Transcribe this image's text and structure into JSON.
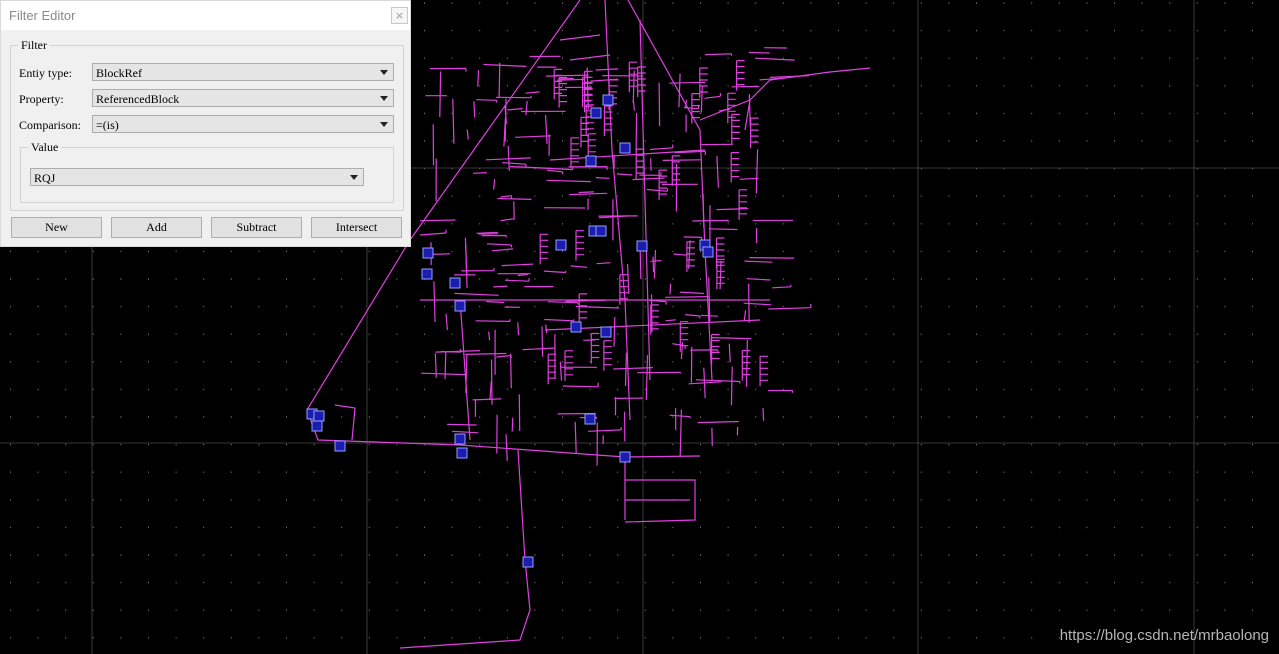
{
  "dialog": {
    "title": "Filter Editor",
    "close_label": "×",
    "filter_group_label": "Filter",
    "entity_type_label": "Entiy type:",
    "entity_type_value": "BlockRef",
    "property_label": "Property:",
    "property_value": "ReferencedBlock",
    "comparison_label": "Comparison:",
    "comparison_value": "=(is)",
    "value_group_label": "Value",
    "value_value": "RQJ",
    "buttons": {
      "new": "New",
      "add": "Add",
      "subtract": "Subtract",
      "intersect": "Intersect"
    }
  },
  "watermark": "https://blog.csdn.net/mrbaolong",
  "colors": {
    "background": "#000000",
    "pipe": "#e040e0",
    "marker_fill": "#1c1cb0",
    "marker_stroke": "#8fa0ff",
    "grid": "#4a4a4a"
  }
}
